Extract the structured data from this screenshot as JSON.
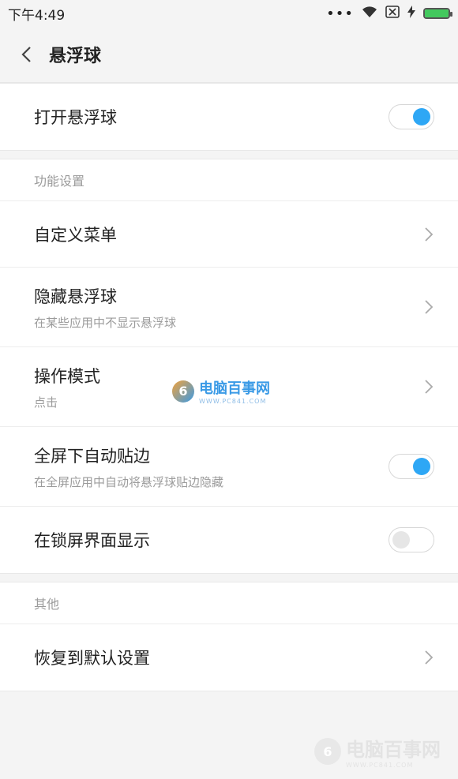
{
  "status_bar": {
    "time": "下午4:49",
    "icons": [
      "more-dots-icon",
      "wifi-icon",
      "sim-x-icon",
      "charging-icon",
      "battery-icon"
    ],
    "battery_level": 1.0
  },
  "header": {
    "title": "悬浮球"
  },
  "main_toggle": {
    "label": "打开悬浮球",
    "on": true
  },
  "function_section": {
    "label": "功能设置",
    "items": [
      {
        "title": "自定义菜单",
        "subtitle": "",
        "control": "chevron"
      },
      {
        "title": "隐藏悬浮球",
        "subtitle": "在某些应用中不显示悬浮球",
        "control": "chevron"
      },
      {
        "title": "操作模式",
        "subtitle": "点击",
        "control": "chevron"
      },
      {
        "title": "全屏下自动贴边",
        "subtitle": "在全屏应用中自动将悬浮球贴边隐藏",
        "control": "toggle",
        "on": true
      },
      {
        "title": "在锁屏界面显示",
        "subtitle": "",
        "control": "toggle",
        "on": false
      }
    ]
  },
  "other_section": {
    "label": "其他",
    "items": [
      {
        "title": "恢复到默认设置",
        "control": "chevron"
      }
    ]
  },
  "watermark": {
    "title": "电脑百事网",
    "url": "WWW.PC841.COM"
  },
  "colors": {
    "accent": "#2ea7f5",
    "background": "#f4f4f4",
    "secondary_text": "#9b9b9b"
  }
}
